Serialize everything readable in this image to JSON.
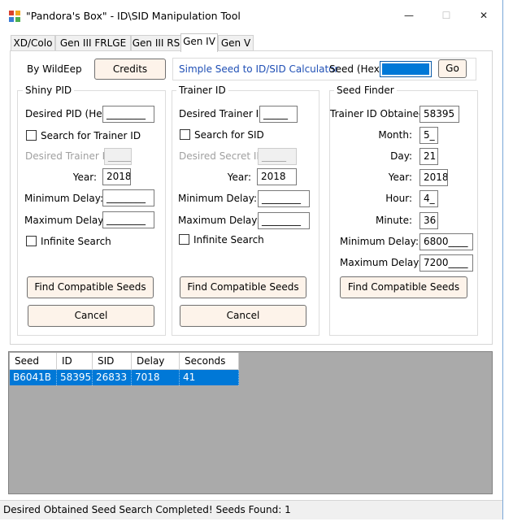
{
  "window": {
    "title": "\"Pandora's Box\" - ID\\SID Manipulation Tool",
    "minimize": "—",
    "maximize": "☐",
    "close": "✕"
  },
  "tabs": [
    {
      "label": "XD/Colo"
    },
    {
      "label": "Gen III FRLGE"
    },
    {
      "label": "Gen III RS"
    },
    {
      "label": "Gen IV",
      "active": true
    },
    {
      "label": "Gen V"
    }
  ],
  "header": {
    "author": "By WildEep",
    "credits_button": "Credits",
    "calculator_link": "Simple Seed to ID/SID Calculator",
    "seed_hex_label": "Seed (Hex):",
    "seed_hex_value": "",
    "go_button": "Go"
  },
  "shiny_pid": {
    "title": "Shiny PID",
    "desired_pid_label": "Desired PID (Hex):",
    "desired_pid_value": "________",
    "search_trainer_label": "Search for Trainer ID",
    "desired_trainer_label": "Desired Trainer ID:",
    "desired_trainer_value": "_____",
    "year_label": "Year:",
    "year_value": "2018",
    "min_delay_label": "Minimum Delay:",
    "min_delay_value": "________",
    "max_delay_label": "Maximum Delay:",
    "max_delay_value": "________",
    "infinite_label": "Infinite Search",
    "find_button": "Find Compatible Seeds",
    "cancel_button": "Cancel"
  },
  "trainer_id": {
    "title": "Trainer ID",
    "desired_trainer_label": "Desired Trainer ID:",
    "desired_trainer_value": "_____",
    "search_sid_label": "Search for SID",
    "desired_secret_label": "Desired Secret ID:",
    "desired_secret_value": "_____",
    "year_label": "Year:",
    "year_value": "2018",
    "min_delay_label": "Minimum Delay:",
    "min_delay_value": "________",
    "max_delay_label": "Maximum Delay:",
    "max_delay_value": "________",
    "infinite_label": "Infinite Search",
    "find_button": "Find Compatible Seeds",
    "cancel_button": "Cancel"
  },
  "seed_finder": {
    "title": "Seed Finder",
    "tid_label": "Trainer ID Obtained:",
    "tid_value": "58395",
    "month_label": "Month:",
    "month_value": "5_",
    "day_label": "Day:",
    "day_value": "21",
    "year_label": "Year:",
    "year_value": "2018",
    "hour_label": "Hour:",
    "hour_value": "4_",
    "minute_label": "Minute:",
    "minute_value": "36",
    "min_delay_label": "Minimum Delay:",
    "min_delay_value": "6800____",
    "max_delay_label": "Maximum Delay:",
    "max_delay_value": "7200____",
    "find_button": "Find Compatible Seeds"
  },
  "results": {
    "columns": [
      "Seed",
      "ID",
      "SID",
      "Delay",
      "Seconds"
    ],
    "rows": [
      [
        "B6041B",
        "58395",
        "26833",
        "7018",
        "41"
      ]
    ],
    "selection_color": "#0078d7"
  },
  "status": {
    "text": "Desired Obtained Seed Search Completed! Seeds Found: 1"
  }
}
